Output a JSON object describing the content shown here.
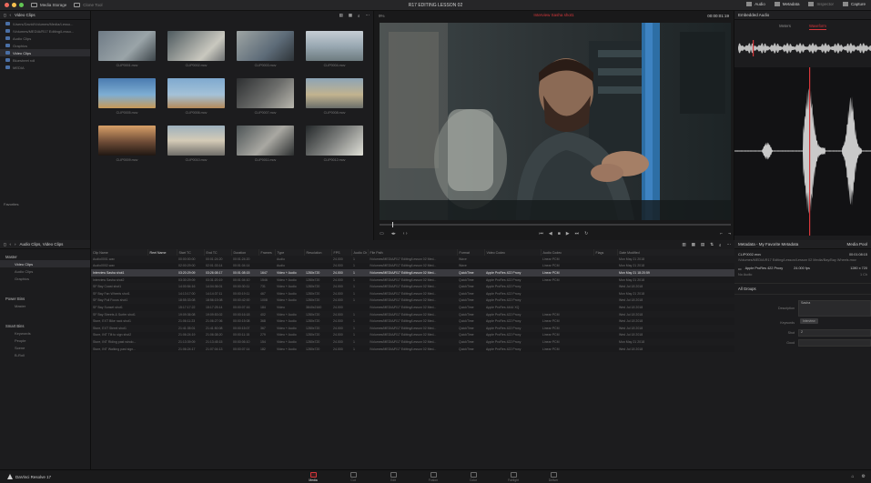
{
  "titlebar": {
    "media_storage": "Media Storage",
    "clone_tool": "Clone Tool",
    "project_title": "R17 EDITING LESSON 02",
    "tabs": [
      "Audio",
      "Metadata",
      "Inspector",
      "Capture"
    ]
  },
  "media_pool": {
    "header": "Video Clips",
    "sidebar": [
      "/Users/David/Volumes/Media/Lesso...",
      "/Volumes/MEDIA/R17 Editing/Lesso...",
      "Audio Clips",
      "Graphics",
      "Video Clips",
      "Bluesheet roll",
      "MEDIA"
    ],
    "selected_index": 4,
    "favorites_label": "Favorites",
    "thumbnails": [
      {
        "name": "CLIP0001.mov"
      },
      {
        "name": "CLIP0002.mov"
      },
      {
        "name": "CLIP0003.mov"
      },
      {
        "name": "CLIP0004.mov"
      },
      {
        "name": "CLIP0005.mov"
      },
      {
        "name": "CLIP0006.mov"
      },
      {
        "name": "CLIP0007.mov"
      },
      {
        "name": "CLIP0008.mov"
      },
      {
        "name": "CLIP0009.mov"
      },
      {
        "name": "CLIP0010.mov"
      },
      {
        "name": "CLIP0011.mov"
      },
      {
        "name": "CLIP0012.mov"
      }
    ]
  },
  "viewer": {
    "zoom": "9%",
    "clip_name": "Interview Sasha shot1",
    "timecode": "00:00:01:19"
  },
  "audio": {
    "header": "Embedded Audio",
    "tabs": [
      "Meters",
      "Waveform"
    ],
    "active_tab": "Waveform"
  },
  "bins": {
    "header": "Audio Clips, Video Clips",
    "groups": [
      {
        "title": "Master",
        "items": [
          "Video Clips",
          "Audio Clips",
          "Graphics"
        ],
        "selected": 0
      },
      {
        "title": "Power Bins",
        "items": [
          "Master"
        ]
      },
      {
        "title": "Smart Bins",
        "items": [
          "Keywords",
          "People",
          "Scene",
          "B-Roll"
        ]
      }
    ]
  },
  "list": {
    "columns": [
      "Clip Name",
      "Reel Name",
      "Start TC",
      "End TC",
      "Duration",
      "Frames",
      "Type",
      "Resolution",
      "FPS",
      "Audio Ch",
      "File Path",
      "Format",
      "Video Codec",
      "Audio Codec",
      "Flags",
      "Date Modified"
    ],
    "sorted_column": "Reel Name",
    "selected_row": 2,
    "rows": [
      [
        "Audio0001.wav",
        "",
        "00:00:00:00",
        "00:01:24:20",
        "00:01:24:20",
        "",
        "Audio",
        "",
        "24.000",
        "1",
        "/Volumes/MEDIA/R17 Editing/Lesson 02 Med...",
        "Wave",
        "",
        "Linear PCM",
        "",
        "Mon May 21 2018"
      ],
      [
        "Audio0002.wav",
        "",
        "02:00:29:00",
        "02:01:33:14",
        "00:01:04:14",
        "",
        "Audio",
        "",
        "24.000",
        "1",
        "/Volumes/MEDIA/R17 Editing/Lesson 02 Med...",
        "Wave",
        "",
        "Linear PCM",
        "",
        "Mon May 21 2018"
      ],
      [
        "Interview Sasha shot1",
        "",
        "03:20:29:09",
        "03:26:08:17",
        "00:01:08:15",
        "1647",
        "Video + Audio",
        "1280x720",
        "24.000",
        "1",
        "/Volumes/MEDIA/R17 Editing/Lesson 02 Med...",
        "QuickTime",
        "Apple ProRes 422 Proxy",
        "Linear PCM",
        "",
        "Mon May 21 18:20:59"
      ],
      [
        "Interview Sasha shot2",
        "",
        "03:30:29:09",
        "03:31:20:19",
        "00:01:04:10",
        "1546",
        "Video + Audio",
        "1280x720",
        "24.000",
        "1",
        "/Volumes/MEDIA/R17 Editing/Lesson 02 Med...",
        "QuickTime",
        "Apple ProRes 422 Proxy",
        "Linear PCM",
        "",
        "Mon May 21 2018"
      ],
      [
        "SF Bay Coast shot1",
        "",
        "14:00:54:16",
        "14:04:36:01",
        "00:00:30:11",
        "731",
        "Video + Audio",
        "1280x720",
        "24.000",
        "1",
        "/Volumes/MEDIA/R17 Editing/Lesson 02 Med...",
        "QuickTime",
        "Apple ProRes 422 Proxy",
        "",
        "",
        "Wed Jul 18 2018"
      ],
      [
        "SF Bay Fan Wheels shot1",
        "",
        "14:13:17:00",
        "14:14:37:11",
        "00:00:19:11",
        "467",
        "Video + Audio",
        "1280x720",
        "24.000",
        "1",
        "/Volumes/MEDIA/R17 Editing/Lesson 02 Med...",
        "QuickTime",
        "Apple ProRes 422 Proxy",
        "",
        "",
        "Mon May 21 2018"
      ],
      [
        "SF Bay Pull Focus shot1",
        "",
        "18:55:33:08",
        "18:56:15:08",
        "00:00:42:00",
        "1008",
        "Video + Audio",
        "1280x720",
        "24.000",
        "1",
        "/Volumes/MEDIA/R17 Editing/Lesson 02 Med...",
        "QuickTime",
        "Apple ProRes 422 Proxy",
        "",
        "",
        "Wed Jul 18 2018"
      ],
      [
        "SF Bay Sunset shot1",
        "",
        "15:17:17:22",
        "15:17:25:14",
        "00:00:07:16",
        "184",
        "Video",
        "3840x2160",
        "24.000",
        "",
        "/Volumes/MEDIA/R17 Editing/Lesson 02 Med...",
        "QuickTime",
        "Apple ProRes 4444 XQ",
        "",
        "",
        "Wed Jul 18 2018"
      ],
      [
        "SF Bay Streets & Surfer shot1",
        "",
        "19:09:36:08",
        "19:09:53:02",
        "00:00:16:18",
        "402",
        "Video + Audio",
        "1280x720",
        "24.000",
        "1",
        "/Volumes/MEDIA/R17 Editing/Lesson 02 Med...",
        "QuickTime",
        "Apple ProRes 422 Proxy",
        "Linear PCM",
        "",
        "Wed Jul 18 2018"
      ],
      [
        "Store, EXT Bike rack shot1",
        "",
        "21:06:11:23",
        "21:06:27:06",
        "00:00:15:08",
        "368",
        "Video + Audio",
        "1280x720",
        "24.000",
        "1",
        "/Volumes/MEDIA/R17 Editing/Lesson 02 Med...",
        "QuickTime",
        "Apple ProRes 422 Proxy",
        "Linear PCM",
        "",
        "Wed Jul 18 2018"
      ],
      [
        "Store, EXT Street shot1",
        "",
        "21:41:35:01",
        "21:41:50:08",
        "00:00:15:07",
        "367",
        "Video + Audio",
        "1280x720",
        "24.000",
        "1",
        "/Volumes/MEDIA/R17 Editing/Lesson 02 Med...",
        "QuickTime",
        "Apple ProRes 422 Proxy",
        "Linear PCM",
        "",
        "Wed Jul 18 2018"
      ],
      [
        "Store, INT Tilt to sign shot2",
        "",
        "21:06:24:19",
        "21:06:38:20",
        "00:00:11:15",
        "279",
        "Video + Audio",
        "1280x720",
        "24.000",
        "1",
        "/Volumes/MEDIA/R17 Editing/Lesson 02 Med...",
        "QuickTime",
        "Apple ProRes 422 Proxy",
        "Linear PCM",
        "",
        "Wed Jul 18 2018"
      ],
      [
        "Store, INT Riding past windo...",
        "",
        "21:13:39:09",
        "21:13:45:15",
        "00:00:06:10",
        "154",
        "Video + Audio",
        "1280x720",
        "24.000",
        "1",
        "/Volumes/MEDIA/R17 Editing/Lesson 02 Med...",
        "QuickTime",
        "Apple ProRes 422 Proxy",
        "Linear PCM",
        "",
        "Mon May 21 2018"
      ],
      [
        "Store, INT Walking past sign...",
        "",
        "21:06:24:17",
        "21:07:04:13",
        "00:00:07:14",
        "182",
        "Video + Audio",
        "1280x720",
        "24.000",
        "1",
        "/Volumes/MEDIA/R17 Editing/Lesson 02 Med...",
        "QuickTime",
        "Apple ProRes 422 Proxy",
        "Linear PCM",
        "",
        "Wed Jul 18 2018"
      ]
    ]
  },
  "metadata": {
    "header": "Metadata - My Favorite Metadata",
    "dropdown": "Media Pool",
    "clip_name": "CLIP0002.mov",
    "clip_tc": "00:01:08:15",
    "clip_path": "/Volumes/MEDIA/R17 Editing/Lesson/Lesson 02 Media/Bay/Bay Wheels.mov",
    "codec": "Apple ProRes 422 Proxy",
    "fps": "24.000 fps",
    "resolution": "1280 x 720",
    "channels": "1 Ch",
    "no_audio": "No Audio",
    "group": "All Groups",
    "fields": [
      {
        "label": "Description",
        "value": "Sasha"
      },
      {
        "label": "Keywords",
        "value": "Interview"
      },
      {
        "label": "Shot",
        "value": "2"
      },
      {
        "label": "Good",
        "value": ""
      }
    ]
  },
  "pagebar": {
    "brand": "DaVinci Resolve 17",
    "pages": [
      "Media",
      "Cut",
      "Edit",
      "Fusion",
      "Color",
      "Fairlight",
      "Deliver"
    ],
    "active_page": "Media"
  },
  "colors": {
    "accent_red": "#d6373b",
    "folder_blue": "#4a6fa5",
    "panel_bg": "#1c1c1e"
  }
}
